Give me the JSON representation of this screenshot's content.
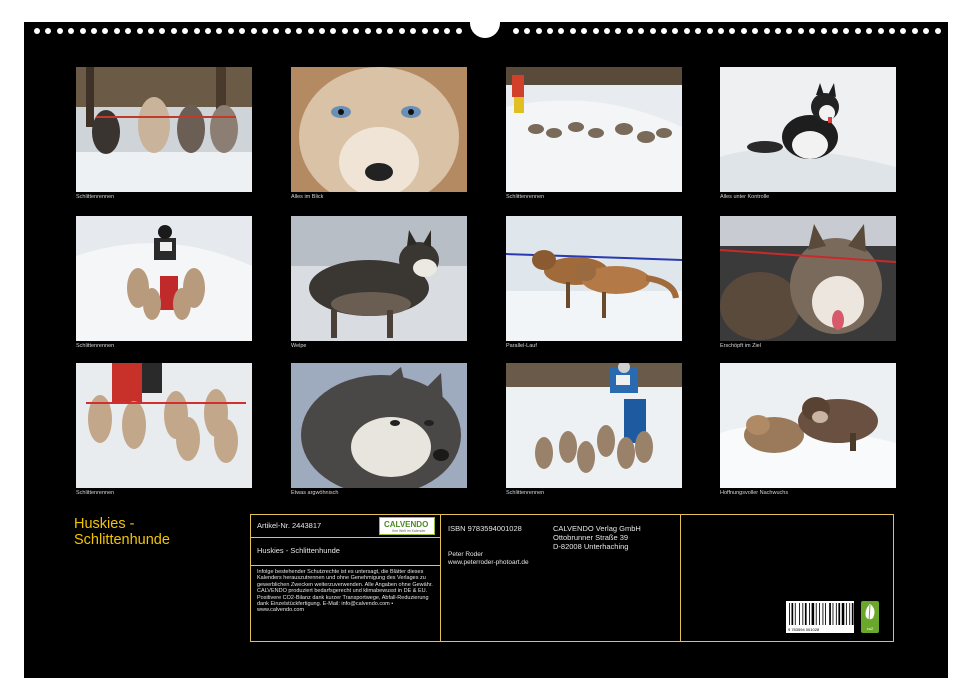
{
  "photos": [
    {
      "caption": "Schlittenrennen",
      "icon": "sled-dog-team-photo"
    },
    {
      "caption": "Alles im Blick",
      "icon": "husky-face-closeup-photo"
    },
    {
      "caption": "Schlittenrennen",
      "icon": "sled-dog-race-photo"
    },
    {
      "caption": "Alles unter Kontrolle",
      "icon": "husky-in-snow-photo"
    },
    {
      "caption": "Schlittenrennen",
      "icon": "musher-with-team-photo"
    },
    {
      "caption": "Welpe",
      "icon": "husky-puppy-photo"
    },
    {
      "caption": "Parallel-Lauf",
      "icon": "running-dogs-photo"
    },
    {
      "caption": "Erschöpft im Ziel",
      "icon": "tired-husky-photo"
    },
    {
      "caption": "Schlittenrennen",
      "icon": "dog-team-harness-photo"
    },
    {
      "caption": "Etwas argwöhnisch",
      "icon": "husky-head-photo"
    },
    {
      "caption": "Schlittenrennen",
      "icon": "musher-sled-race-photo"
    },
    {
      "caption": "Hoffnungsvoller Nachwuchs",
      "icon": "puppies-in-snow-photo"
    }
  ],
  "calendar_title": "Huskies - Schlittenhunde",
  "info": {
    "article_no": "Artikel-Nr. 2443817",
    "logo_text": "CALVENDO",
    "logo_sub": "Ihre Welt im Kalender",
    "product_title": "Huskies - Schlittenhunde",
    "legal_text": "Infolge bestehender Schutzrechte ist es untersagt, die Blätter dieses Kalenders herauszutrennen und ohne Genehmigung des Verlages zu gewerblichen Zwecken weiterzuverwenden. Alle Angaben ohne Gewähr. CALVENDO produziert bedarfsgerecht und klimabewusst in DE & EU. Positivere CO2-Bilanz dank kurzer Transportwege, Abfall-Reduzierung dank Einzelstückfertigung. E-Mail: info@calvendo.com • www.calvendo.com",
    "isbn": "ISBN 9783594001028",
    "publisher_name": "CALVENDO Verlag GmbH",
    "publisher_street": "Ottobrunner Straße 39",
    "publisher_city": "D-82008 Unterhaching",
    "author": "Peter Roder",
    "author_web": "www.peterroder-photoart.de",
    "barcode_number": "9 783594 001028",
    "eco_label": "co2"
  },
  "colors": {
    "background": "#000000",
    "title": "#f2c400",
    "border": "#e2c152"
  }
}
